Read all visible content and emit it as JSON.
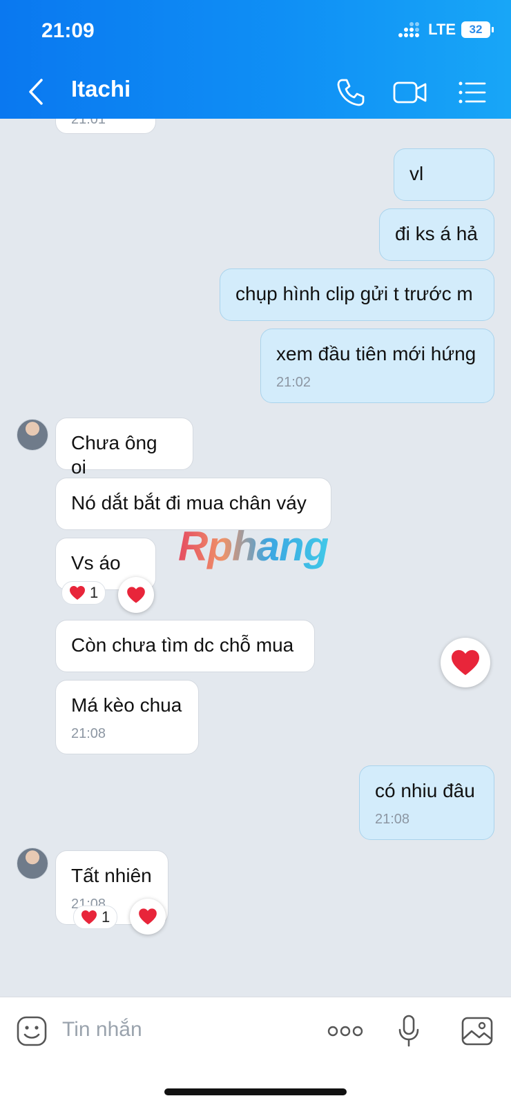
{
  "status_bar": {
    "time": "21:09",
    "network": "LTE",
    "battery": "32"
  },
  "header": {
    "contact_name": "Itachi"
  },
  "chat": {
    "cut_off_time": "21:01",
    "messages": [
      {
        "text": "vl"
      },
      {
        "text": "đi ks á hả"
      },
      {
        "text": "chụp hình clip gửi t trước m"
      },
      {
        "text": "xem đầu tiên mới hứng",
        "time": "21:02"
      },
      {
        "text": "Chưa ông oi"
      },
      {
        "text": "Nó dắt bắt đi mua chân váy"
      },
      {
        "text": "Vs áo",
        "reaction_count": "1"
      },
      {
        "text": "Còn chưa tìm dc chỗ mua"
      },
      {
        "text": "Má kèo chua",
        "time": "21:08"
      },
      {
        "text": "có nhiu đâu",
        "time": "21:08"
      },
      {
        "text": "Tất nhiên",
        "time": "21:08",
        "reaction_count": "1"
      }
    ],
    "watermark": "Rphang"
  },
  "composer": {
    "placeholder": "Tin nhắn"
  },
  "colors": {
    "header_blue": "#0f8ff5",
    "outgoing_bubble": "#d3ecfb",
    "incoming_bubble": "#ffffff",
    "heart": "#e8253a"
  },
  "icons": [
    "back-icon",
    "phone-icon",
    "video-call-icon",
    "menu-icon",
    "sticker-icon",
    "more-icon",
    "microphone-icon",
    "image-icon",
    "heart-icon"
  ]
}
